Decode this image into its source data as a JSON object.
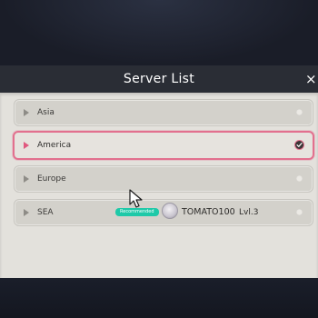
{
  "header": {
    "title": "Server List",
    "close_glyph": "×"
  },
  "servers": [
    {
      "name": "Asia",
      "selected": false
    },
    {
      "name": "America",
      "selected": true
    },
    {
      "name": "Europe",
      "selected": false
    },
    {
      "name": "SEA",
      "selected": false
    }
  ],
  "recommended_badge": "Recommended",
  "player": {
    "name": "TOMATO100",
    "level": "Lvl.3"
  },
  "colors": {
    "accent": "#e2708e",
    "badge": "#1ec9a8",
    "panel": "#e3e1dc",
    "header": "#2a2d35"
  },
  "icons": {
    "close": "close-icon",
    "row_arrow": "play-arrow-icon",
    "selected": "checkmark-icon",
    "cursor": "mouse-pointer-icon"
  }
}
